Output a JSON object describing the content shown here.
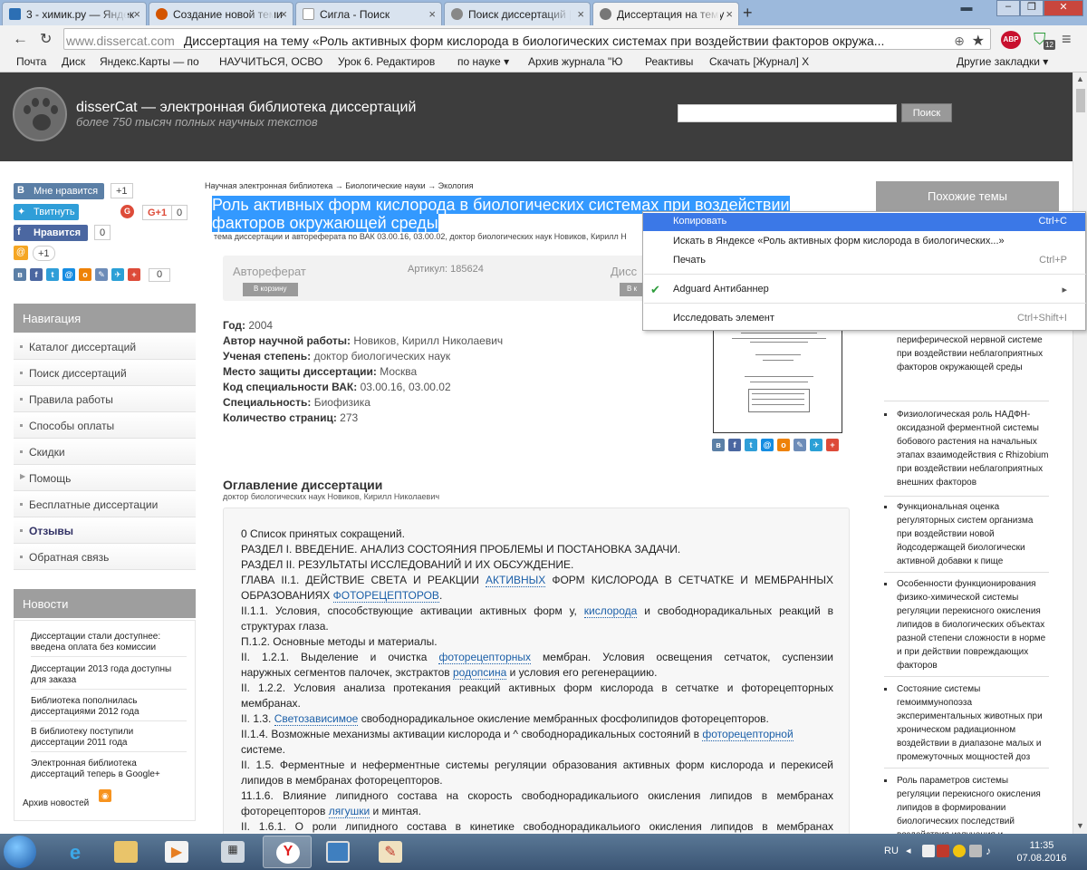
{
  "browser": {
    "tabs": [
      {
        "label": "3 - химик.ру — Яндек",
        "color": "#2c6fb4",
        "active": false
      },
      {
        "label": "Создание новой теми",
        "color": "#d35400",
        "active": false
      },
      {
        "label": "Сигла - Поиск",
        "color": "#ffffff",
        "active": false
      },
      {
        "label": "Поиск диссертаций |",
        "color": "#888888",
        "active": false
      },
      {
        "label": "Диссертация на тему",
        "color": "#777777",
        "active": true
      }
    ],
    "url_domain": "www.dissercat.com",
    "url_title": "Диссертация на тему «Роль активных форм кислорода в биологических системах при воздействии факторов окружа...",
    "abp_label": "ABP",
    "adguard_badge": "12",
    "bookmarks": [
      "Почта",
      "Диск",
      "Яндекс.Карты — по",
      "НАУЧИТЬСЯ, ОСВО",
      "Урок 6. Редактиров",
      "по науке ▾",
      "Архив журнала \"Ю",
      "Реактивы",
      "Скачать [Журнал] Х"
    ],
    "other_bookmarks": "Другие закладки"
  },
  "site": {
    "name": "disserCat — электронная библиотека диссертаций",
    "tagline": "более 750 тысяч полных научных текстов",
    "search_button": "Поиск"
  },
  "social": {
    "vk_like": "Мне нравится",
    "vk_count": "+1",
    "tweet": "Твитнуть",
    "gplus": "G+1",
    "gplus_count": "0",
    "fb_like": "Нравится",
    "fb_count": "0",
    "mail_count": "+1",
    "share_count": "0"
  },
  "navigation": {
    "title": "Навигация",
    "items": [
      "Каталог диссертаций",
      "Поиск диссертаций",
      "Правила работы",
      "Способы оплаты",
      "Скидки",
      "Помощь",
      "Бесплатные диссертации",
      "Отзывы",
      "Обратная связь"
    ]
  },
  "news": {
    "title": "Новости",
    "items": [
      "Диссертации стали доступнее: введена оплата без комиссии",
      "Диссертации 2013 года доступны для заказа",
      "Библиотека пополнилась диссертациями 2012 года",
      "В библиотеку поступили диссертации 2011 года",
      "Электронная библиотека диссертаций теперь в Google+"
    ],
    "archive": "Архив новостей"
  },
  "document": {
    "breadcrumb": "Научная электронная библиотека → Биологические науки → Экология",
    "title": "Роль активных форм кислорода в биологических системах при воздействии факторов окружающей среды",
    "subtitle": "тема диссертации и автореферата по ВАК 03.00.16, 03.00.02, доктор биологических наук Новиков, Кирилл Н",
    "abstract_label": "Автореферат",
    "article": "Артикул: 185624",
    "dissertation_label": "Дисс",
    "cart_button": "В корзину",
    "cart_button2": "В к",
    "meta": [
      {
        "k": "Год:",
        "v": "2004"
      },
      {
        "k": "Автор научной работы:",
        "v": "Новиков, Кирилл Николаевич"
      },
      {
        "k": "Ученая степень:",
        "v": "доктор биологических наук"
      },
      {
        "k": "Место защиты диссертации:",
        "v": "Москва"
      },
      {
        "k": "Код специальности ВАК:",
        "v": "03.00.16, 03.00.02"
      },
      {
        "k": "Специальность:",
        "v": "Биофизика"
      },
      {
        "k": "Количество страниц:",
        "v": "273"
      }
    ],
    "toc_title": "Оглавление диссертации",
    "toc_author": "доктор биологических наук Новиков, Кирилл Николаевич"
  },
  "toc": {
    "l1": "0 Список принятых сокращений.",
    "l2": "РАЗДЕЛ I. ВВЕДЕНИЕ. АНАЛИЗ СОСТОЯНИЯ ПРОБЛЕМЫ И ПОСТАНОВКА ЗАДАЧИ.",
    "l3": "РАЗДЕЛ II. РЕЗУЛЬТАТЫ ИССЛЕДОВАНИЙ И ИХ ОБСУЖДЕНИЕ.",
    "l4a": "ГЛАВА II.1. ДЕЙСТВИЕ СВЕТА И РЕАКЦИИ",
    "l4b": "АКТИВНЫХ",
    "l4c": "ФОРМ КИСЛОРОДА В СЕТЧАТКЕ И МЕМБРАННЫХ",
    "l5a": "ОБРАЗОВАНИЯХ",
    "l5b": "ФОТОРЕЦЕПТОРОВ",
    "l5c": ".",
    "l6a": "II.1.1. Условия, способствующие активации активных форм у,",
    "l6b": "кислорода",
    "l6c": "и свободнорадикальных реакций в",
    "l7": "структурах глаза.",
    "l8": "П.1.2. Основные методы и материалы.",
    "l9a": "II. 1.2.1. Выделение и очистка",
    "l9b": "фоторецепторных",
    "l9c": "мембран. Условия освещения сетчаток, суспензии",
    "l10a": "наружных сегментов палочек, экстрактов",
    "l10b": "родопсина",
    "l10c": "и условия его регенерациию.",
    "l11": "II. 1.2.2. Условия анализа протекания реакций активных форм кислорода в сетчатке и фоторецепторных",
    "l12": "мембранах.",
    "l13a": "II. 1.3.",
    "l13b": "Светозависимое",
    "l13c": "свободнорадикальное окисление мембранных фосфолипидов фоторецепторов.",
    "l14a": "II.1.4. Возможные механизмы активации кислорода и ^ свободнорадикальных состояний в",
    "l14b": "фоторецепторной",
    "l15": "системе.",
    "l16": "II. 1.5. Ферментные и неферментные системы регуляции образования активных форм кислорода и перекисей",
    "l17": "липидов в мембранах фоторецепторов.",
    "l18": "11.1.6. Влияние липидного состава на скорость свободнорадикальиого окисления липидов в мембранах",
    "l19a": "фоторецепторов",
    "l19b": "лягушки",
    "l19c": "и минтая.",
    "l20": "II. 1.6.1. О роли липидного состава в кинетике свободнорадикальиого окисления липидов в мембранах"
  },
  "similar": {
    "title": "Похожие темы",
    "items": [
      "электрофизиологических и иммунологических изменений в периферической нервной системе при воздействии неблагоприятных факторов окружающей среды",
      "Физиологическая роль НАДФН-оксидазной ферментной системы бобового растения на начальных этапах взаимодействия с Rhizobium при воздействии неблагоприятных внешних факторов",
      "Функциональная оценка регуляторных систем организма при воздействии новой йодсодержащей биологически активной добавки к пище",
      "Особенности функционирования физико-химической системы регуляции перекисного окисления липидов в биологических объектах разной степени сложности в норме и при действии повреждающих факторов",
      "Состояние системы гемоиммунопоэза экспериментальных животных при хроническом радиационном воздействии в диапазоне малых и промежуточных мощностей доз",
      "Роль параметров системы регуляции перекисного окисления липидов в формировании биологических последствий воздействия излучения и"
    ]
  },
  "context_menu": {
    "items": [
      {
        "label": "Копировать",
        "shortcut": "Ctrl+C"
      },
      {
        "label": "Искать в Яндексе «Роль активных форм кислорода в биологических...»",
        "shortcut": ""
      },
      {
        "label": "Печать",
        "shortcut": "Ctrl+P"
      },
      {
        "label": "Adguard Антибаннер",
        "shortcut": "▸"
      },
      {
        "label": "Исследовать элемент",
        "shortcut": "Ctrl+Shift+I"
      }
    ]
  },
  "taskbar": {
    "lang": "RU",
    "time": "11:35",
    "date": "07.08.2016"
  }
}
